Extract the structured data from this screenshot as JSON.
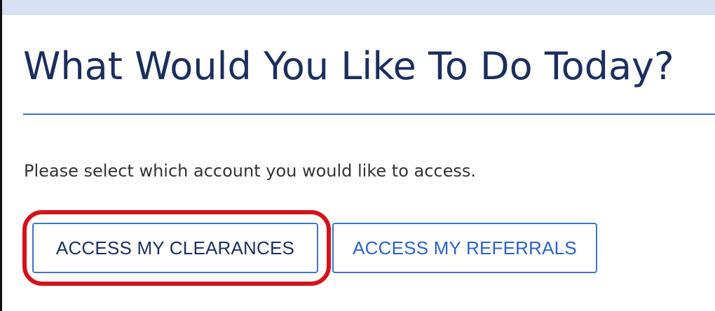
{
  "page": {
    "heading": "What Would You Like To Do Today?",
    "prompt": "Please select which account you would like to access."
  },
  "actions": {
    "clearances_label": "ACCESS MY CLEARANCES",
    "referrals_label": "ACCESS MY REFERRALS"
  },
  "colors": {
    "heading": "#1b2f5e",
    "accent_blue": "#3f74cc",
    "highlight_red": "#d3121b",
    "topbar": "#d6e2f3"
  }
}
